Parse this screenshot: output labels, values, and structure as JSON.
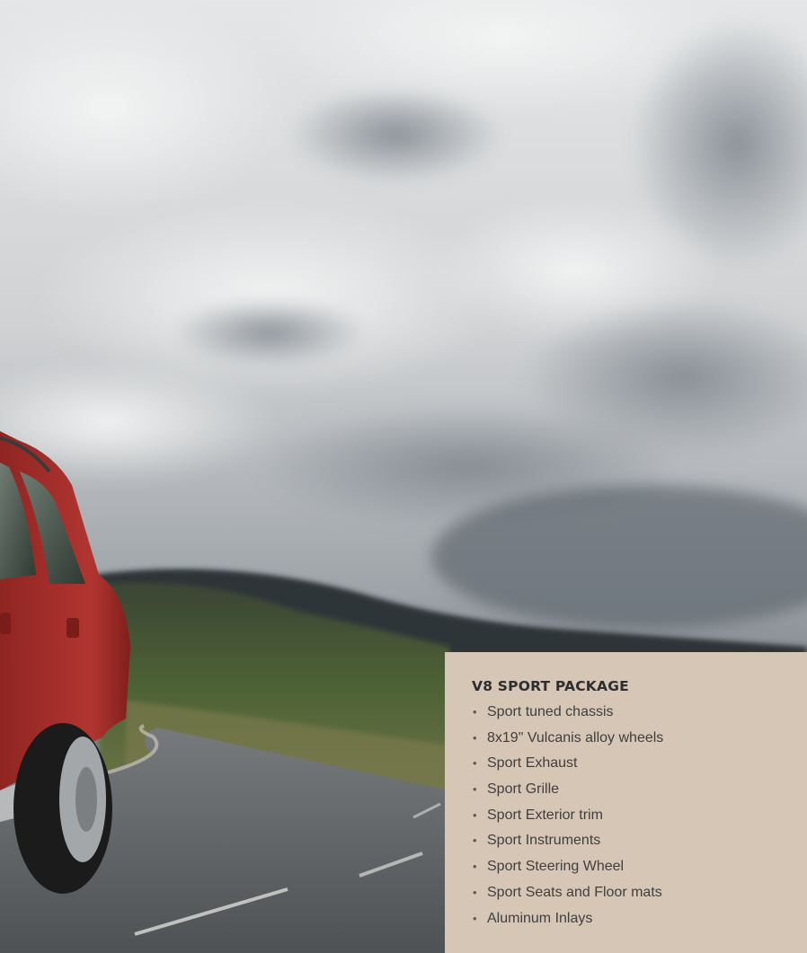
{
  "panel": {
    "title": "V8 SPORT PACKAGE",
    "bullet": "•",
    "items": [
      "Sport tuned chassis",
      "8x19\" Vulcanis alloy wheels",
      "Sport Exhaust",
      "Sport Grille",
      "Sport Exterior trim",
      "Sport Instruments",
      "Sport Steering Wheel",
      "Sport Seats and Floor mats",
      "Aluminum Inlays"
    ]
  },
  "colors": {
    "panel_background": "#d6c6b6",
    "text": "#3f3f3f",
    "car_body": "#a8302c",
    "sky": "#c9cbcd",
    "road": "#5e6164",
    "foliage": "#4a5b33"
  }
}
